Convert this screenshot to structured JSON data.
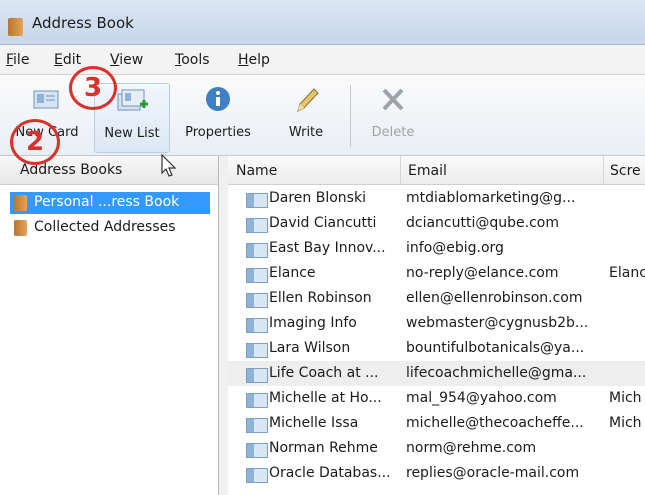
{
  "window": {
    "title": "Address Book"
  },
  "menu": [
    {
      "label": "File",
      "mnemonic": "F",
      "rest": "ile"
    },
    {
      "label": "Edit",
      "mnemonic": "E",
      "rest": "dit"
    },
    {
      "label": "View",
      "mnemonic": "V",
      "rest": "iew"
    },
    {
      "label": "Tools",
      "mnemonic": "T",
      "rest": "ools"
    },
    {
      "label": "Help",
      "mnemonic": "H",
      "rest": "elp"
    }
  ],
  "toolbar": {
    "new_card": "New Card",
    "new_list": "New List",
    "properties": "Properties",
    "write": "Write",
    "delete": "Delete"
  },
  "annotations": {
    "marker_2": "2",
    "marker_3": "3"
  },
  "sidebar": {
    "header": "Address Books",
    "books": [
      {
        "label": "Personal ...ress Book",
        "selected": true
      },
      {
        "label": "Collected Addresses",
        "selected": false
      }
    ]
  },
  "contacts": {
    "columns": {
      "name": "Name",
      "email": "Email",
      "screen": "Scre"
    },
    "rows": [
      {
        "name": "Daren Blonski",
        "email": "mtdiablomarketing@g...",
        "screen": ""
      },
      {
        "name": "David Ciancutti",
        "email": "dciancutti@qube.com",
        "screen": ""
      },
      {
        "name": "East Bay Innov...",
        "email": "info@ebig.org",
        "screen": ""
      },
      {
        "name": "Elance",
        "email": "no-reply@elance.com",
        "screen": "Elanc"
      },
      {
        "name": "Ellen Robinson",
        "email": "ellen@ellenrobinson.com",
        "screen": ""
      },
      {
        "name": "Imaging Info",
        "email": "webmaster@cygnusb2b...",
        "screen": ""
      },
      {
        "name": "Lara Wilson",
        "email": "bountifulbotanicals@ya...",
        "screen": ""
      },
      {
        "name": "Life Coach at ...",
        "email": "lifecoachmichelle@gma...",
        "screen": ""
      },
      {
        "name": "Michelle at Ho...",
        "email": "mal_954@yahoo.com",
        "screen": "Mich"
      },
      {
        "name": "Michelle Issa",
        "email": "michelle@thecoacheffe...",
        "screen": "Mich"
      },
      {
        "name": "Norman Rehme",
        "email": "norm@rehme.com",
        "screen": ""
      },
      {
        "name": "Oracle Databas...",
        "email": "replies@oracle-mail.com",
        "screen": ""
      }
    ]
  },
  "colors": {
    "selection": "#3399ff",
    "marker": "#d9312b"
  }
}
